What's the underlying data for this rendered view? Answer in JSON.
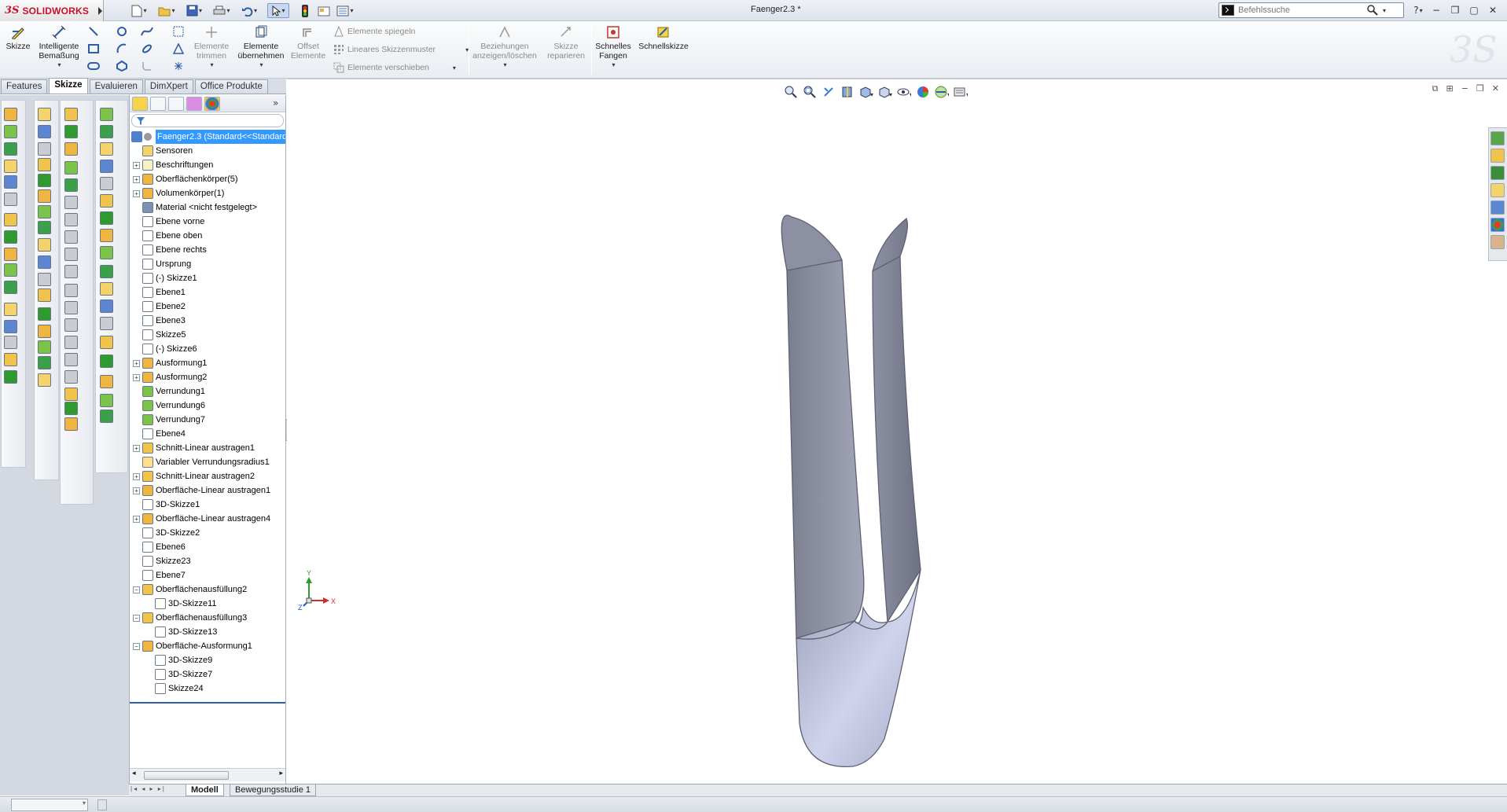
{
  "app": {
    "brand_ds": "3S",
    "brand_name": "SOLIDWORKS",
    "document_title": "Faenger2.3 *"
  },
  "search": {
    "placeholder": "Befehlssuche"
  },
  "command_manager": {
    "skizze": "Skizze",
    "intelligente_1": "Intelligente",
    "intelligente_2": "Bemaßung",
    "trimmen_1": "Elemente",
    "trimmen_2": "trimmen",
    "uebernehmen_1": "Elemente",
    "uebernehmen_2": "übernehmen",
    "offset_1": "Offset",
    "offset_2": "Elemente",
    "spiegeln": "Elemente spiegeln",
    "muster": "Lineares Skizzenmuster",
    "verschieben": "Elemente verschieben",
    "beziehungen_1": "Beziehungen",
    "beziehungen_2": "anzeigen/löschen",
    "reparieren_1": "Skizze",
    "reparieren_2": "reparieren",
    "fangen_1": "Schnelles",
    "fangen_2": "Fangen",
    "schnellskizze": "Schnellskizze"
  },
  "tabs": [
    "Features",
    "Skizze",
    "Evaluieren",
    "DimXpert",
    "Office Produkte"
  ],
  "active_tab": "Skizze",
  "tree": {
    "root": "Faenger2.3  (Standard<<Standard",
    "items": [
      {
        "label": "Sensoren",
        "icon": "sensor-icon",
        "expandable": false,
        "indent": 0
      },
      {
        "label": "Beschriftungen",
        "icon": "annotation-icon",
        "expandable": true,
        "indent": 0
      },
      {
        "label": "Oberflächenkörper(5)",
        "icon": "surface-bodies-icon",
        "expandable": true,
        "indent": 0
      },
      {
        "label": "Volumenkörper(1)",
        "icon": "solid-bodies-icon",
        "expandable": true,
        "indent": 0
      },
      {
        "label": "Material <nicht festgelegt>",
        "icon": "material-icon",
        "expandable": false,
        "indent": 0
      },
      {
        "label": "Ebene vorne",
        "icon": "plane-icon",
        "expandable": false,
        "indent": 0
      },
      {
        "label": "Ebene oben",
        "icon": "plane-icon",
        "expandable": false,
        "indent": 0
      },
      {
        "label": "Ebene rechts",
        "icon": "plane-icon",
        "expandable": false,
        "indent": 0
      },
      {
        "label": "Ursprung",
        "icon": "origin-icon",
        "expandable": false,
        "indent": 0
      },
      {
        "label": "(-) Skizze1",
        "icon": "sketch-icon",
        "expandable": false,
        "indent": 0
      },
      {
        "label": "Ebene1",
        "icon": "plane-icon",
        "expandable": false,
        "indent": 0
      },
      {
        "label": "Ebene2",
        "icon": "plane-icon",
        "expandable": false,
        "indent": 0
      },
      {
        "label": "Ebene3",
        "icon": "plane-icon",
        "expandable": false,
        "indent": 0
      },
      {
        "label": "Skizze5",
        "icon": "sketch-icon",
        "expandable": false,
        "indent": 0
      },
      {
        "label": "(-) Skizze6",
        "icon": "sketch-icon",
        "expandable": false,
        "indent": 0
      },
      {
        "label": "Ausformung1",
        "icon": "loft-icon",
        "expandable": true,
        "indent": 0
      },
      {
        "label": "Ausformung2",
        "icon": "loft-icon",
        "expandable": true,
        "indent": 0
      },
      {
        "label": "Verrundung1",
        "icon": "fillet-icon",
        "expandable": false,
        "indent": 0
      },
      {
        "label": "Verrundung6",
        "icon": "fillet-icon",
        "expandable": false,
        "indent": 0
      },
      {
        "label": "Verrundung7",
        "icon": "fillet-icon",
        "expandable": false,
        "indent": 0
      },
      {
        "label": "Ebene4",
        "icon": "plane-icon",
        "expandable": false,
        "indent": 0
      },
      {
        "label": "Schnitt-Linear austragen1",
        "icon": "cut-extrude-icon",
        "expandable": true,
        "indent": 0
      },
      {
        "label": "Variabler Verrundungsradius1",
        "icon": "variable-fillet-icon",
        "expandable": false,
        "indent": 0
      },
      {
        "label": "Schnitt-Linear austragen2",
        "icon": "cut-extrude-icon",
        "expandable": true,
        "indent": 0
      },
      {
        "label": "Oberfläche-Linear austragen1",
        "icon": "surface-extrude-icon",
        "expandable": true,
        "indent": 0
      },
      {
        "label": "3D-Skizze1",
        "icon": "3d-sketch-icon",
        "expandable": false,
        "indent": 0
      },
      {
        "label": "Oberfläche-Linear austragen4",
        "icon": "surface-extrude-icon",
        "expandable": true,
        "indent": 0
      },
      {
        "label": "3D-Skizze2",
        "icon": "3d-sketch-icon",
        "expandable": false,
        "indent": 0
      },
      {
        "label": "Ebene6",
        "icon": "plane-icon",
        "expandable": false,
        "indent": 0
      },
      {
        "label": "Skizze23",
        "icon": "sketch-icon",
        "expandable": false,
        "indent": 0
      },
      {
        "label": "Ebene7",
        "icon": "plane-icon",
        "expandable": false,
        "indent": 0
      },
      {
        "label": "Oberflächenausfüllung2",
        "icon": "surface-fill-icon",
        "expandable": true,
        "expanded": true,
        "indent": 0
      },
      {
        "label": "3D-Skizze11",
        "icon": "3d-sketch-icon",
        "expandable": false,
        "indent": 1
      },
      {
        "label": "Oberflächenausfüllung3",
        "icon": "surface-fill-icon",
        "expandable": true,
        "expanded": true,
        "indent": 0
      },
      {
        "label": "3D-Skizze13",
        "icon": "3d-sketch-icon",
        "expandable": false,
        "indent": 1
      },
      {
        "label": "Oberfläche-Ausformung1",
        "icon": "surface-loft-icon",
        "expandable": true,
        "expanded": true,
        "indent": 0
      },
      {
        "label": "3D-Skizze9",
        "icon": "3d-sketch-icon",
        "expandable": false,
        "indent": 1
      },
      {
        "label": "3D-Skizze7",
        "icon": "3d-sketch-icon",
        "expandable": false,
        "indent": 1
      },
      {
        "label": "Skizze24",
        "icon": "sketch-icon",
        "expandable": false,
        "indent": 1
      }
    ]
  },
  "bottom_tabs": [
    "Modell",
    "Bewegungsstudie 1"
  ],
  "active_bottom_tab": "Modell",
  "triad": {
    "x": "X",
    "y": "Y",
    "z": "Z"
  },
  "colors": {
    "brand": "#c8102e",
    "selection": "#3399ff",
    "model_surface": "#8f93a6",
    "model_edge": "#6d7081"
  }
}
